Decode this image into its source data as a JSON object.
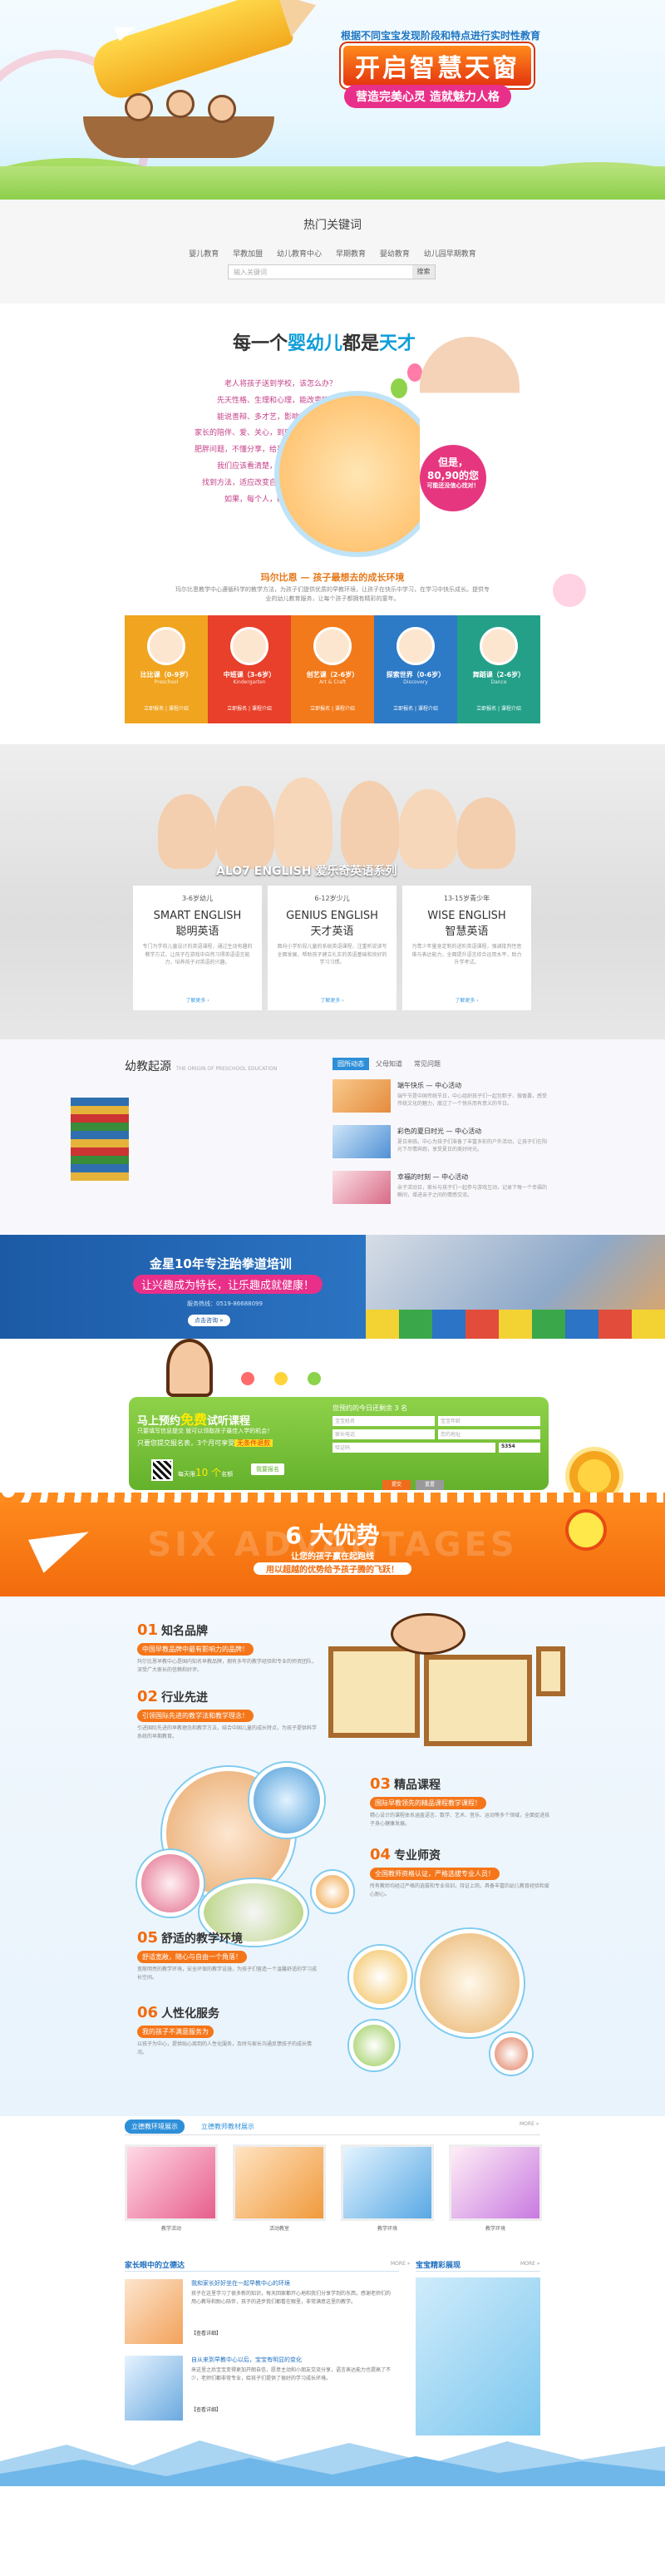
{
  "hero": {
    "tagline": "根据不同宝宝发现阶段和特点进行实时性教育",
    "title": "开启智慧天窗",
    "subtitle": "营造完美心灵  造就魅力人格"
  },
  "search": {
    "title": "热门关键词",
    "keywords": [
      "婴儿教育",
      "早教加盟",
      "幼儿教育中心",
      "早期教育",
      "婴幼教育",
      "幼儿园早期教育"
    ],
    "placeholder": "输入关键词",
    "button": "搜索"
  },
  "infant": {
    "title_pre": "每一个",
    "title_em": "婴幼儿",
    "title_mid": "都是",
    "title_em2": "天才",
    "questions": [
      "老人将孩子送到学校，该怎么办？",
      "先天性格、生理和心理，能改变吗？",
      "能说善辩、多才艺，影响是哪方面？",
      "家长的陪伴、爱、关心，到底起多大作用？",
      "肥胖问题，不懂分享，给孩子怎样的指导？",
      "我们应该看清楚，理解孩子的内心？",
      "找到方法，适应改变自我，用行动交流，",
      "如果，每个人，都有自己的天赋。"
    ],
    "badge_line1": "但是，",
    "badge_line2": "80,90的您",
    "badge_line3": "可能还没信心找对！"
  },
  "env": {
    "title": "玛尔比恩 — 孩子最想去的成长环境",
    "desc": "玛尔比恩教学中心遵循科学的教学方法，为孩子们提供优质的早教环境，让孩子在快乐中学习，在学习中快乐成长。提供专业的幼儿教育服务，让每个孩子都拥有精彩的童年。",
    "cards": [
      {
        "name": "比比课（0-9岁）",
        "color": "#f0a41f",
        "label": "Preschool"
      },
      {
        "name": "中班课（3-6岁）",
        "color": "#e8402a",
        "label": "Kindergarten"
      },
      {
        "name": "创艺课（2-6岁）",
        "color": "#f27a1a",
        "label": "Art & Craft"
      },
      {
        "name": "探索世界（0-6岁）",
        "color": "#2d7ac6",
        "label": "Discovery"
      },
      {
        "name": "舞蹈课（2-6岁）",
        "color": "#24a089",
        "label": "Dance"
      }
    ],
    "card_links": "立即报名 | 课程介绍"
  },
  "alo7": {
    "title": "ALO7 ENGLISH 爱乐奇英语系列",
    "boxes": [
      {
        "age": "3-6岁幼儿",
        "en": "SMART ENGLISH",
        "cn": "聪明英语",
        "desc": "专门为学前儿童设计的英语课程，通过生动有趣的教学方式，让孩子在游戏中自然习得英语语言能力，培养孩子对英语的兴趣。",
        "more": "了解更多 ›"
      },
      {
        "age": "6-12岁少儿",
        "en": "GENIUS ENGLISH",
        "cn": "天才英语",
        "desc": "面向小学阶段儿童的系统英语课程，注重听说读写全面发展，帮助孩子建立扎实的英语基础和良好的学习习惯。",
        "more": "了解更多 ›"
      },
      {
        "age": "13-15岁青少年",
        "en": "WISE ENGLISH",
        "cn": "智慧英语",
        "desc": "为青少年量身定制的进阶英语课程，强调批判性思维与表达能力，全面提升语言综合运用水平，助力升学考试。",
        "more": "了解更多 ›"
      }
    ]
  },
  "news": {
    "title": "幼教起源",
    "title_en": "THE ORIGIN OF PRESCHOOL EDUCATION",
    "tabs": [
      "园所动态",
      "父母知道",
      "常见问题"
    ],
    "items": [
      {
        "title": "端午快乐 — 中心活动",
        "desc": "端午节是中国传统节日，中心组织孩子们一起包粽子、做香囊，感受传统文化的魅力，度过了一个快乐而有意义的节日。"
      },
      {
        "title": "彩色的夏日时光 — 中心活动",
        "desc": "夏日来临，中心为孩子们准备了丰富多彩的户外活动，让孩子们在阳光下尽情奔跑，享受夏日的美好时光。"
      },
      {
        "title": "幸福的时刻 — 中心活动",
        "desc": "亲子活动日，家长与孩子们一起参与游戏互动，记录下每一个幸福的瞬间，增进亲子之间的情感交流。"
      }
    ]
  },
  "banner": {
    "headline": "金星10年专注跆拳道培训",
    "pill": "让兴趣成为特长，让乐趣成就健康！",
    "phone": "服务热线：0519-86688099",
    "button": "点击咨询 »"
  },
  "trial": {
    "title_pre": "马上预约",
    "title_em": "免费",
    "title_post": "试听课程",
    "line1": "只要填写信息提交 就可以领取孩子最佳入学的机会！",
    "line2_pre": "只要您提交报名表，3个月可享受",
    "line2_em": "无条件退款",
    "count_pre": "每天限",
    "count_num": "10 个",
    "count_post": "名额",
    "submit_left": "我要报名",
    "form_title": "您预约的今日还剩余 3 名",
    "fields": [
      "宝宝姓名",
      "宝宝年龄",
      "家长电话",
      "您的地址",
      "验证码"
    ],
    "captcha": "5354",
    "submit": "提交",
    "reset": "重置"
  },
  "six": {
    "bg_text": "SIX ADVANTAGES",
    "title": "6 大优势",
    "sub1": "让您的孩子赢在起跑线",
    "sub2": "用以超越的优势给予孩子腾的飞跃！"
  },
  "adv": {
    "items": [
      {
        "n": "01",
        "name": "知名品牌",
        "tag": "中国早教品牌中最有影响力的品牌！",
        "text": "玛尔比恩早教中心是国内知名早教品牌，拥有多年的教学经验和专业的师资团队，深受广大家长的信赖和好评。"
      },
      {
        "n": "02",
        "name": "行业先进",
        "tag": "引领国际先进的教学法和教学理念！",
        "text": "引进国际先进的早教理念和教学方法，结合中国儿童的成长特点，为孩子提供科学系统的早期教育。"
      },
      {
        "n": "03",
        "name": "精品课程",
        "tag": "国际早教领先的精品课程教学课程！",
        "text": "精心设计的课程体系涵盖语言、数学、艺术、音乐、运动等多个领域，全面促进孩子身心健康发展。"
      },
      {
        "n": "04",
        "name": "专业师资",
        "tag": "全国教师资格认证，严格选拔专业人员！",
        "text": "所有教师均经过严格的选拔和专业培训，持证上岗，具备丰富的幼儿教育经验和爱心耐心。"
      },
      {
        "n": "05",
        "name": "舒适的教学环境",
        "tag": "舒适宽敞，随心与自由一个角落！",
        "text": "宽敞明亮的教学环境，安全环保的教学设施，为孩子们营造一个温馨舒适的学习成长空间。"
      },
      {
        "n": "06",
        "name": "人性化服务",
        "tag": "我的孩子不满意服务为",
        "text": "以孩子为中心，提供贴心周到的人性化服务，及时与家长沟通反馈孩子的成长情况。"
      }
    ]
  },
  "files": {
    "tabs": [
      "立德教环境展示",
      "立德教师教材展示"
    ],
    "more": "MORE »",
    "captions": [
      "教学活动",
      "活动教室",
      "教学环境",
      "教学环境"
    ]
  },
  "bottom": {
    "left_title": "家长眼中的立德达",
    "left_more": "MORE »",
    "right_title": "宝宝精彩展现",
    "right_more": "MORE »",
    "items": [
      {
        "title": "我和家长好好坐在一起早教中心的环境",
        "desc": "孩子在这里学习了很多新的知识，每天回家都开心地和我们分享学到的东西，感谢老师们的用心教导和耐心陪伴，孩子的进步我们都看在眼里，非常满意这里的教学。",
        "more": "【查看详细】"
      },
      {
        "title": "自从来到早教中心以后，宝宝有明显的变化",
        "desc": "来这里之后宝宝变得更加开朗自信，愿意主动和小朋友交流分享，语言表达能力也提高了不少，老师们都非常专业，给孩子们提供了很好的学习成长环境。",
        "more": "【查看详细】"
      }
    ]
  }
}
